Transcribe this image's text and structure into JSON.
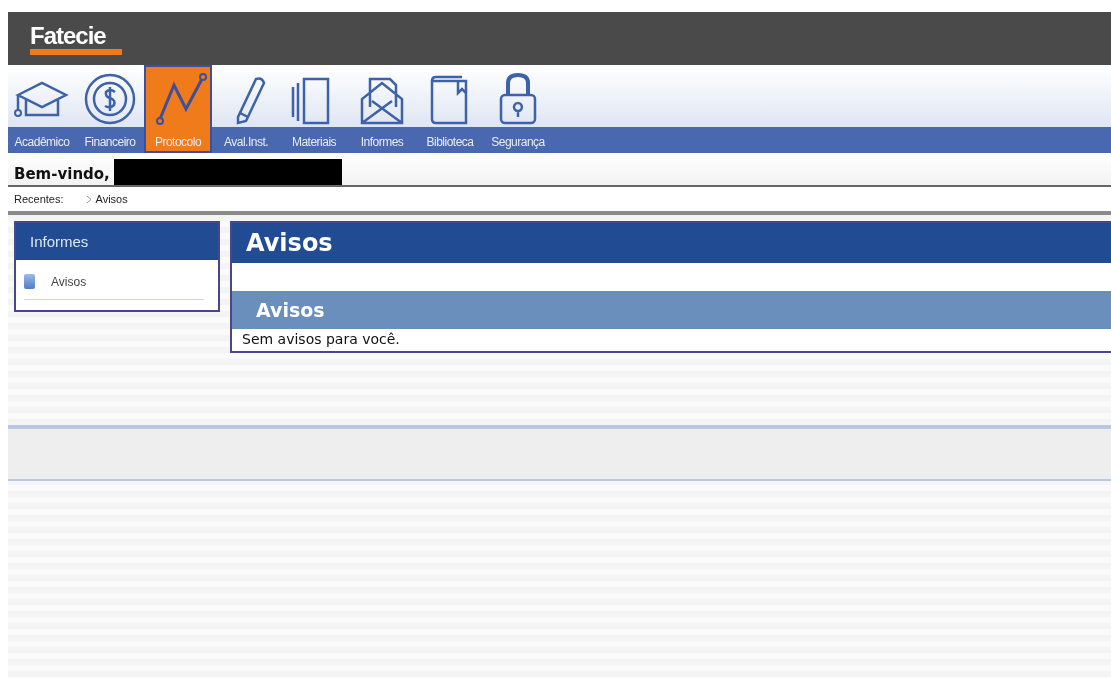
{
  "header": {
    "logo": "Fatecie"
  },
  "nav": [
    {
      "label": "Acadêmico",
      "kind": "cap",
      "selected": false
    },
    {
      "label": "Financeiro",
      "kind": "coin",
      "selected": false
    },
    {
      "label": "Protocolo",
      "kind": "line",
      "selected": true
    },
    {
      "label": "Aval.Inst.",
      "kind": "pencil",
      "selected": false
    },
    {
      "label": "Materiais",
      "kind": "book",
      "selected": false
    },
    {
      "label": "Informes",
      "kind": "mail",
      "selected": false
    },
    {
      "label": "Biblioteca",
      "kind": "folder",
      "selected": false
    },
    {
      "label": "Segurança",
      "kind": "lock",
      "selected": false
    }
  ],
  "welcome": "Bem-vindo,",
  "breadcrumb": {
    "label": "Recentes:",
    "items": [
      "Avisos"
    ]
  },
  "sidebar": {
    "title": "Informes",
    "items": [
      {
        "label": "Avisos"
      }
    ]
  },
  "main": {
    "title": "Avisos",
    "section": "Avisos",
    "message": "Sem avisos para você."
  }
}
